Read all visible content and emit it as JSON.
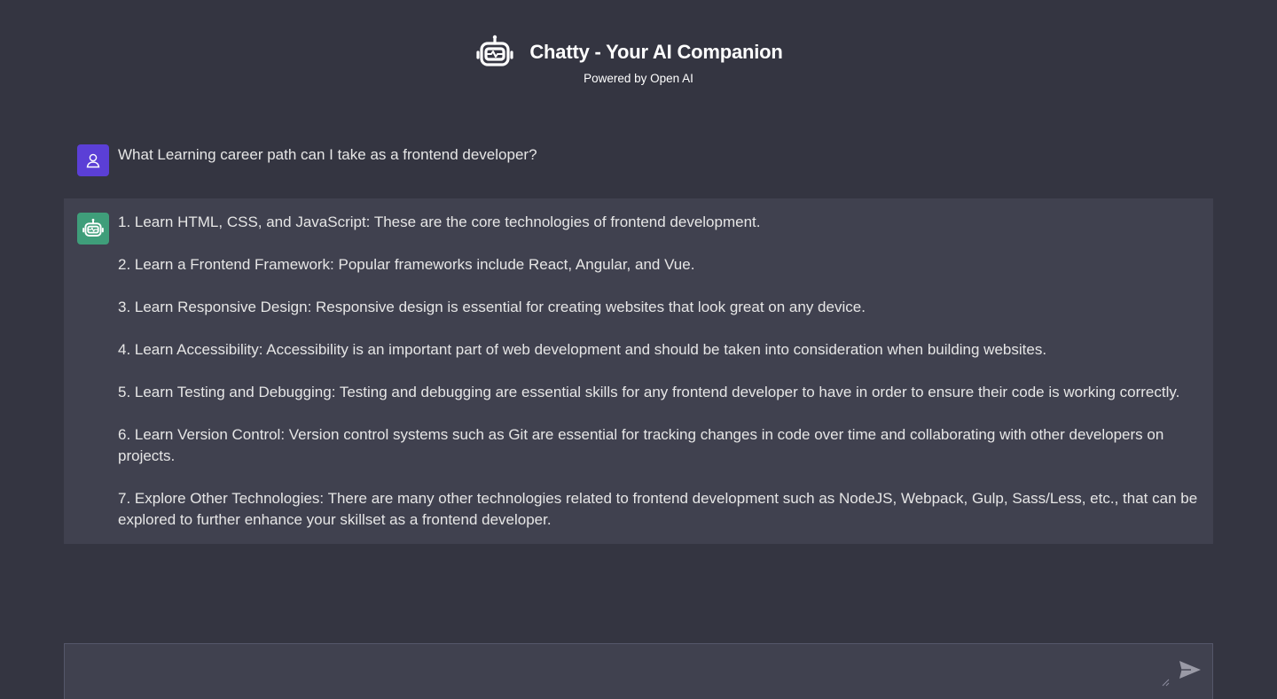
{
  "header": {
    "title": "Chatty - Your AI Companion",
    "subtitle": "Powered by Open AI",
    "logo_icon": "robot-icon"
  },
  "conversation": {
    "user_message": {
      "avatar_icon": "user-icon",
      "avatar_color": "#5b3fd6",
      "text": "What Learning career path can I take as a frontend developer?"
    },
    "bot_message": {
      "avatar_icon": "robot-icon",
      "avatar_color": "#3f9e7a",
      "paragraphs": [
        "1. Learn HTML, CSS, and JavaScript: These are the core technologies of frontend development.",
        "2. Learn a Frontend Framework: Popular frameworks include React, Angular, and Vue.",
        "3. Learn Responsive Design: Responsive design is essential for creating websites that look great on any device.",
        "4. Learn Accessibility: Accessibility is an important part of web development and should be taken into consideration when building websites.",
        "5. Learn Testing and Debugging: Testing and debugging are essential skills for any frontend developer to have in order to ensure their code is working correctly.",
        "6. Learn Version Control: Version control systems such as Git are essential for tracking changes in code over time and collaborating with other developers on projects.",
        "7. Explore Other Technologies: There are many other technologies related to frontend development such as NodeJS, Webpack, Gulp, Sass/Less, etc., that can be explored to further enhance your skillset as a frontend developer."
      ]
    }
  },
  "composer": {
    "value": "",
    "placeholder": "",
    "send_icon": "send-icon"
  },
  "colors": {
    "background": "#343541",
    "panel": "#40414f",
    "text": "#e6e6e6"
  }
}
